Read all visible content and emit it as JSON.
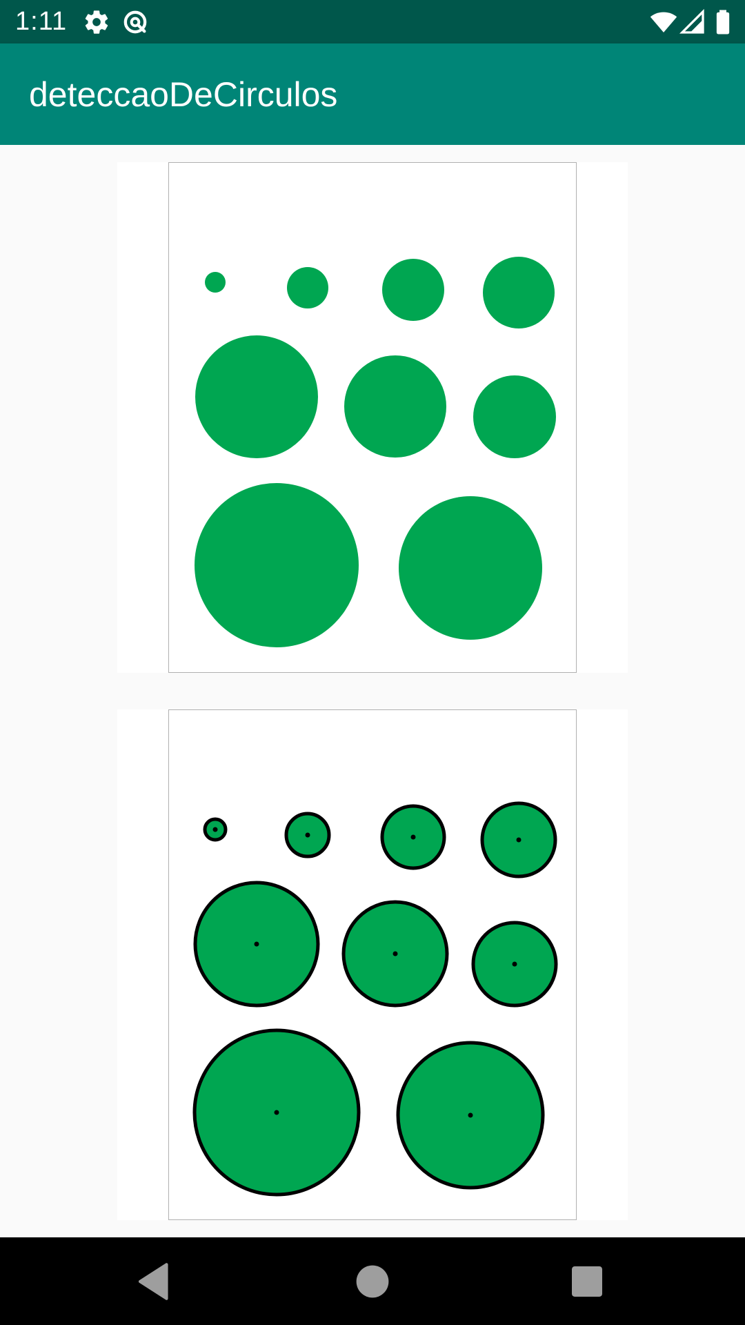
{
  "status_bar": {
    "time": "1:11",
    "icons": [
      "gear-icon",
      "data-saver-icon",
      "wifi-icon",
      "signal-icon",
      "battery-icon"
    ]
  },
  "app_bar": {
    "title": "deteccaoDeCirculos"
  },
  "colors": {
    "status_bar": "#00574b",
    "app_bar": "#008577",
    "circle_fill": "#00a651",
    "outline": "#000000",
    "nav_bar": "#000000",
    "nav_icon": "#9e9e9e"
  },
  "images": [
    {
      "name": "original-image",
      "detected_outlines": false
    },
    {
      "name": "detected-circles-image",
      "detected_outlines": true
    }
  ],
  "navigation": {
    "buttons": [
      "back-icon",
      "home-icon",
      "recents-icon"
    ]
  }
}
